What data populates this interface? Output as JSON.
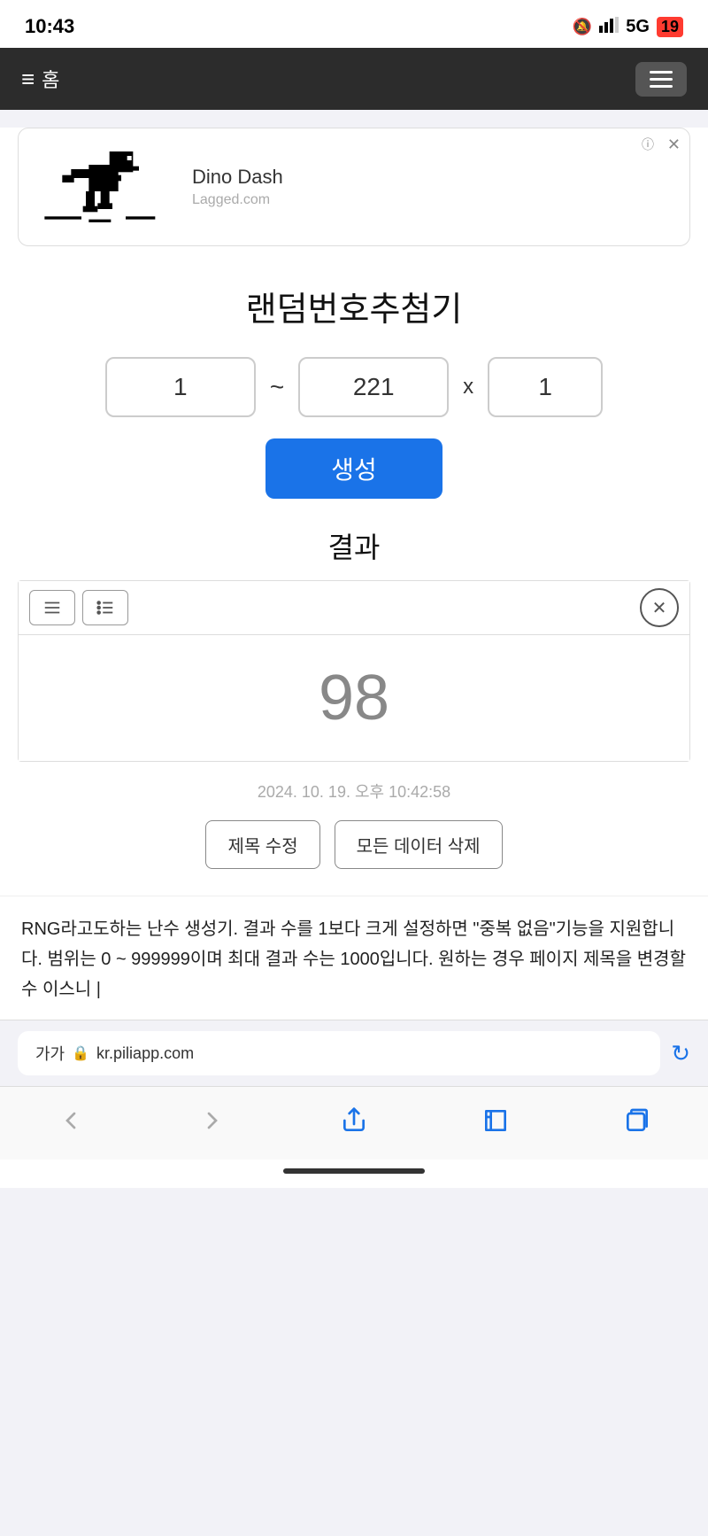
{
  "statusBar": {
    "time": "10:43",
    "bell": "🔕",
    "signal": "signal",
    "network": "5G",
    "battery": "19"
  },
  "navBar": {
    "homeLabel": "홈",
    "menuButton": "menu"
  },
  "ad": {
    "infoLabel": "ⓘ",
    "closeLabel": "✕",
    "title": "Dino Dash",
    "source": "Lagged.com"
  },
  "page": {
    "title": "랜덤번호추첨기",
    "minValue": "1",
    "maxValue": "221",
    "countValue": "1",
    "tildeSeparator": "~",
    "multiplySeparator": "x",
    "generateLabel": "생성",
    "resultLabel": "결과",
    "resultNumber": "98",
    "timestamp": "2024. 10. 19. 오후 10:42:58",
    "editTitleLabel": "제목 수정",
    "deleteAllLabel": "모든 데이터 삭제",
    "description": "RNG라고도하는 난수 생성기. 결과 수를 1보다 크게 설정하면 \"중복 없음\"기능을 지원합니다. 범위는 0 ~ 999999이며 최대 결과 수는 1000입니다. 원하는 경우 페이지 제목을 변경할 수 이스니 |"
  },
  "addressBar": {
    "prefix": "가가",
    "lock": "🔒",
    "url": "kr.piliapp.com",
    "reload": "↻"
  },
  "bottomToolbar": {
    "back": "back",
    "forward": "forward",
    "share": "share",
    "bookmarks": "bookmarks",
    "tabs": "tabs"
  }
}
